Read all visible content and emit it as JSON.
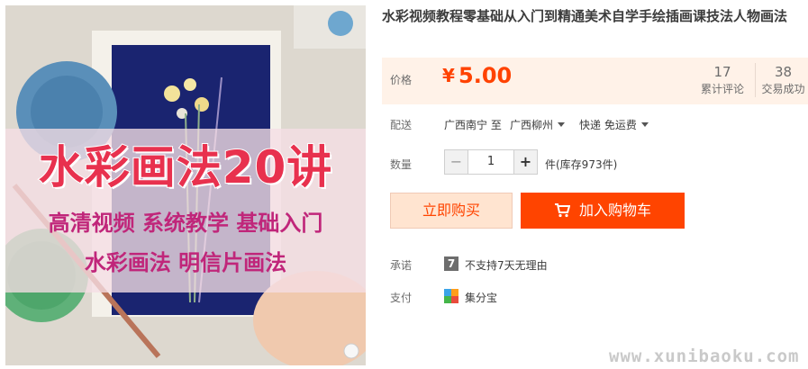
{
  "gallery": {
    "banner_title": "水彩画法20讲",
    "line1": "高清视频 系统教学 基础入门",
    "line2": "水彩画法 明信片画法"
  },
  "product": {
    "title": "水彩视频教程零基础从入门到精通美术自学手绘插画课技法人物画法"
  },
  "price": {
    "label": "价格",
    "currency": "¥",
    "value": "5.00",
    "reviews_count": "17",
    "reviews_label": "累计评论",
    "sales_count": "38",
    "sales_label": "交易成功"
  },
  "shipping": {
    "label": "配送",
    "from": "广西南宁 至",
    "to": "广西柳州",
    "method": "快递 免运费"
  },
  "quantity": {
    "label": "数量",
    "minus": "−",
    "value": "1",
    "plus": "+",
    "stock": "件(库存973件)"
  },
  "actions": {
    "buy_now": "立即购买",
    "add_to_cart": "加入购物车"
  },
  "promise": {
    "label": "承诺",
    "icon_text": "7",
    "text": "不支持7天无理由"
  },
  "payment": {
    "label": "支付",
    "method": "集分宝"
  },
  "watermark": "www.xunibaoku.com",
  "colors": {
    "accent": "#ff4400",
    "price": "#ff4200",
    "price_bg": "#fff2e8",
    "buy_bg": "#ffe4d0"
  },
  "icons": [
    "cart-icon",
    "caret-down-icon",
    "promise-7day-icon",
    "jifenbao-icon"
  ]
}
